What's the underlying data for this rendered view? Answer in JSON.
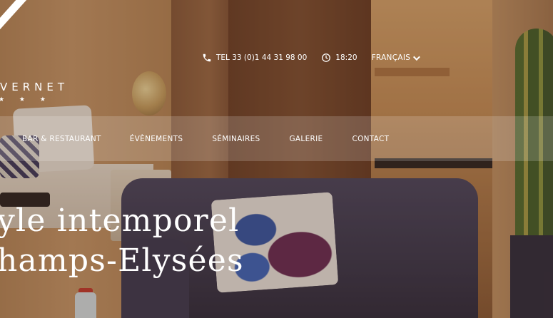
{
  "logo": {
    "name": "VERNET",
    "stars": "★ ★ ★"
  },
  "topbar": {
    "phone": "TEL 33 (0)1 44 31 98 00",
    "time": "18:20",
    "language": "FRANÇAIS"
  },
  "nav": {
    "items": [
      "BAR & RESTAURANT",
      "ÉVÈNEMENTS",
      "SÉMINAIRES",
      "GALERIE",
      "CONTACT"
    ]
  },
  "hero": {
    "line1": "yle intemporel",
    "line2": "hamps-Elysées"
  }
}
